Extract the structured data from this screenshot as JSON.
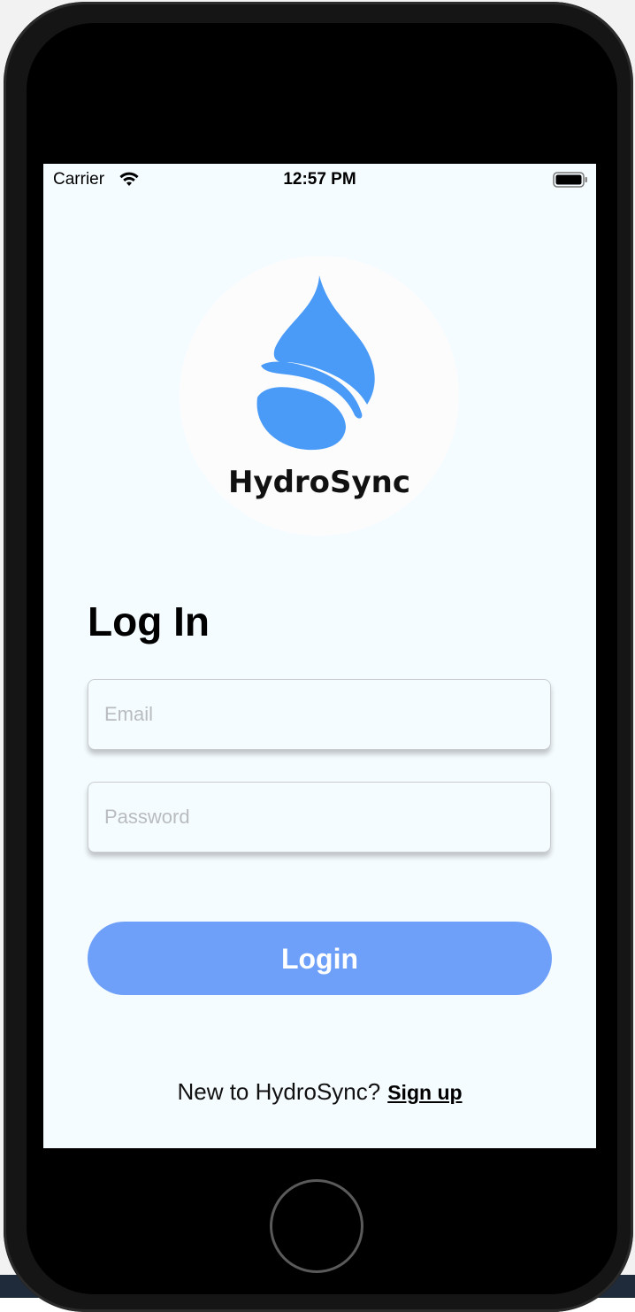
{
  "status_bar": {
    "carrier": "Carrier",
    "time": "12:57 PM",
    "wifi_icon": "wifi-icon",
    "battery_icon": "battery-icon"
  },
  "logo": {
    "icon": "water-drop-icon",
    "text": "HydroSync",
    "drop_color": "#4a9bf8"
  },
  "login": {
    "title": "Log In",
    "email_placeholder": "Email",
    "email_value": "",
    "password_placeholder": "Password",
    "password_value": "",
    "button_label": "Login",
    "button_color": "#6fa0f9"
  },
  "footer": {
    "prompt": "New to HydroSync?",
    "signup_label": "Sign up"
  },
  "colors": {
    "screen_background": "#f5fcff",
    "accent": "#6fa0f9"
  }
}
